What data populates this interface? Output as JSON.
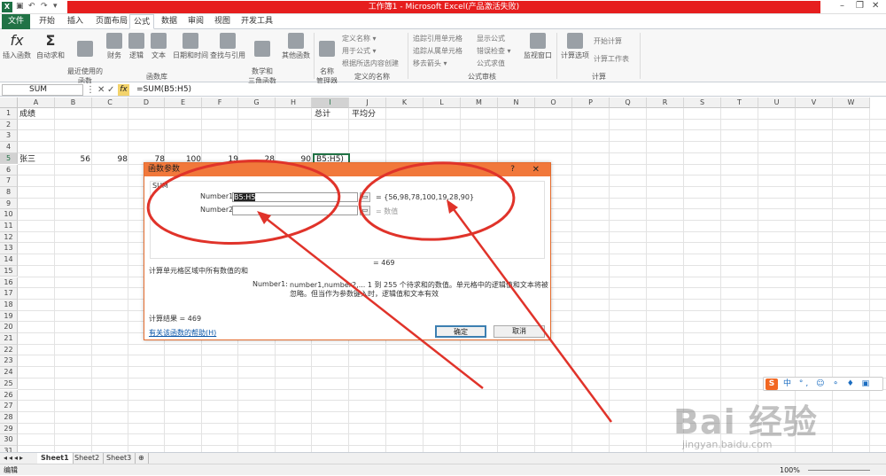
{
  "titlebar": {
    "title": "工作簿1 - Microsoft Excel(产品激活失败)",
    "app_icon": "X"
  },
  "tabs": [
    "文件",
    "开始",
    "插入",
    "页面布局",
    "公式",
    "数据",
    "审阅",
    "视图",
    "开发工具"
  ],
  "ribbon": {
    "insert_fn": "插入函数",
    "autosum": "自动求和",
    "recent": "最近使用的\n函数",
    "finance": "财务",
    "logic": "逻辑",
    "text": "文本",
    "datetime": "日期和时间",
    "lookup": "查找与引用",
    "math": "数学和\n三角函数",
    "other": "其他函数",
    "group_library": "函数库",
    "name_mgr": "名称\n管理器",
    "define_name": "定义名称 ▾",
    "use_in_formula": "用于公式 ▾",
    "create_from_sel": "根据所选内容创建",
    "group_names": "定义的名称",
    "trace_prec": "追踪引用单元格",
    "trace_dep": "追踪从属单元格",
    "remove_arrows": "移去箭头 ▾",
    "show_formulas": "显示公式",
    "error_check": "错误检查 ▾",
    "eval_formula": "公式求值",
    "watch": "监视窗口",
    "group_audit": "公式审核",
    "calc_options": "计算选项",
    "calc_now": "开始计算",
    "calc_sheet": "计算工作表",
    "group_calc": "计算"
  },
  "formula_bar": {
    "name_box": "SUM",
    "formula": "=SUM(B5:H5)"
  },
  "columns": [
    "A",
    "B",
    "C",
    "D",
    "E",
    "F",
    "G",
    "H",
    "I",
    "J",
    "K",
    "L",
    "M",
    "N",
    "O",
    "P",
    "Q",
    "R",
    "S",
    "T",
    "U",
    "V",
    "W"
  ],
  "rows": [
    "1",
    "2",
    "3",
    "4",
    "5",
    "6",
    "7",
    "8",
    "9",
    "10",
    "11",
    "12",
    "13",
    "14",
    "15",
    "16",
    "17",
    "18",
    "19",
    "20",
    "21",
    "22",
    "23",
    "24",
    "25",
    "26",
    "27",
    "28",
    "29",
    "30",
    "31"
  ],
  "cells": {
    "A1": "成绩",
    "I1": "总计",
    "J1": "平均分",
    "A5": "张三",
    "B5": "56",
    "C5": "98",
    "D5": "78",
    "E5": "100",
    "F5": "19",
    "G5": "28",
    "H5": "90",
    "I5": "B5:H5)"
  },
  "dialog": {
    "title": "函数参数",
    "help_glyph": "?",
    "close_glyph": "✕",
    "fn_name": "SUM",
    "arg1_label": "Number1",
    "arg1_value": "B5:H5",
    "arg1_result": "=  {56,98,78,100,19,28,90}",
    "arg2_label": "Number2",
    "arg2_value": "",
    "arg2_result": "=  数值",
    "total_result": "=  469",
    "description": "计算单元格区域中所有数值的和",
    "arg_help_label": "Number1:",
    "arg_help_line1": "number1,number2,... 1 到 255 个待求和的数值。单元格中的逻辑值和文本将被",
    "arg_help_line2": "忽略。但当作为参数键入时，逻辑值和文本有效",
    "calc_result": "计算结果 =   469",
    "help_link": "有关该函数的帮助(H)",
    "ok": "确定",
    "cancel": "取消"
  },
  "sheet_tabs": [
    "Sheet1",
    "Sheet2",
    "Sheet3"
  ],
  "status": {
    "mode": "编辑",
    "zoom": "100%"
  },
  "ime": {
    "logo": "S",
    "text": "中 °, ☺ ⚬ ♦ ▣"
  },
  "watermark": {
    "text": "Bai 经验",
    "url": "jingyan.baidu.com"
  },
  "colors": {
    "title_red": "#e61e1e",
    "excel_green": "#217346",
    "dialog_title": "#f1783b",
    "annotation_red": "#e0332a"
  }
}
